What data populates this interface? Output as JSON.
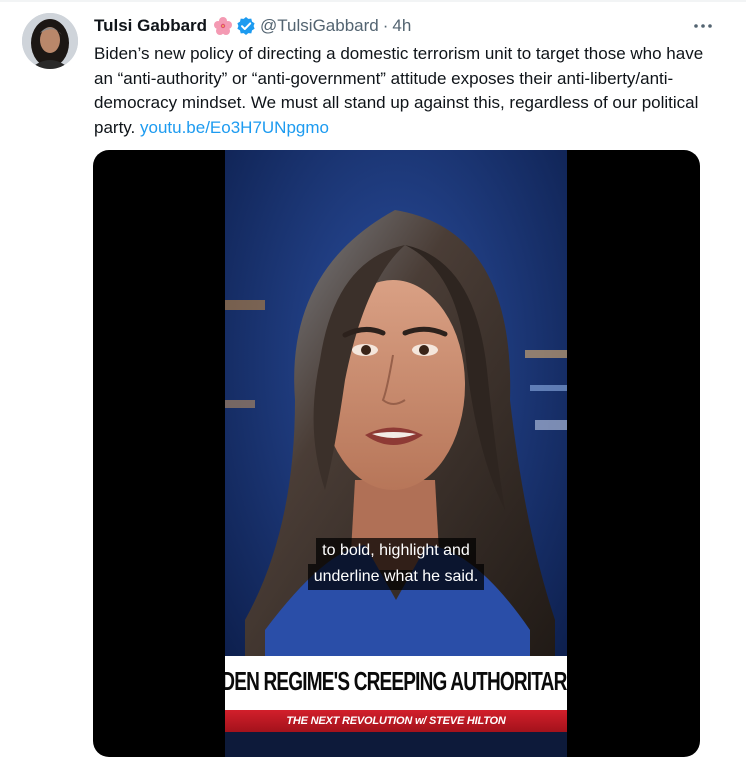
{
  "tweet": {
    "author_name": "Tulsi Gabbard",
    "author_handle": "@TulsiGabbard",
    "separator": "·",
    "timestamp": "4h",
    "emoji_icon": "hibiscus-flower-icon",
    "verified_icon": "verified-badge-icon",
    "more_icon": "more-options-icon",
    "body_text": "Biden’s new policy of directing a domestic terrorism unit to target those who have an “anti-authority” or “anti-government” attitude exposes their anti-liberty/anti-democracy mindset. We must all stand up against this, regardless of our political party.",
    "link_text": "youtu.be/Eo3H7UNpgmo"
  },
  "media": {
    "caption_line1": "to bold, highlight and",
    "caption_line2": "underline what he said.",
    "headline": "THE BIDEN REGIME'S CREEPING AUTHORITARIANISM",
    "show_title": "THE NEXT REVOLUTION w/ STEVE HILTON"
  },
  "colors": {
    "link": "#1d9bf0",
    "secondary_text": "#536471",
    "verified": "#1d9bf0",
    "banner_red": "#c41a25"
  }
}
